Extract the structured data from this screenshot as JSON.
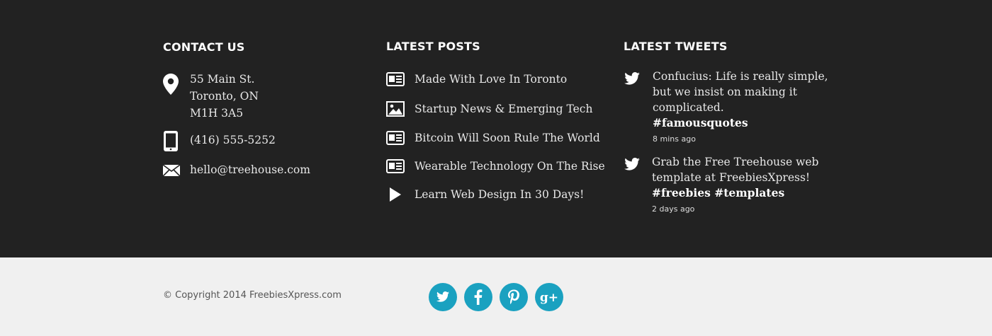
{
  "contact": {
    "title": "CONTACT US",
    "address": [
      "55 Main St.",
      "Toronto, ON",
      "M1H 3A5"
    ],
    "phone": "(416) 555-5252",
    "email": "hello@treehouse.com",
    "icons": [
      "map-pin-icon",
      "phone-icon",
      "envelope-icon"
    ]
  },
  "posts": {
    "title": "LATEST POSTS",
    "items": [
      {
        "label": "Made With Love In Toronto",
        "icon": "article-icon"
      },
      {
        "label": "Startup News & Emerging Tech",
        "icon": "image-icon"
      },
      {
        "label": "Bitcoin Will Soon Rule The World",
        "icon": "article-icon"
      },
      {
        "label": "Wearable Technology On The Rise",
        "icon": "article-icon"
      },
      {
        "label": "Learn Web Design In 30 Days!",
        "icon": "play-icon"
      }
    ]
  },
  "tweets": {
    "title": "LATEST TWEETS",
    "items": [
      {
        "text": "Confucius: Life is really simple, but we insist on making it complicated.",
        "tags": "#famousquotes",
        "time": "8 mins ago",
        "icon": "twitter-bird-icon"
      },
      {
        "text": "Grab the Free Treehouse web template at FreebiesXpress!",
        "tags": "#freebies #templates",
        "time": "2 days ago",
        "icon": "twitter-bird-icon"
      }
    ]
  },
  "footer": {
    "copyright": "© Copyright 2014 FreebiesXpress.com",
    "social": [
      {
        "name": "twitter",
        "icon": "twitter-icon"
      },
      {
        "name": "facebook",
        "icon": "facebook-icon"
      },
      {
        "name": "pinterest",
        "icon": "pinterest-icon"
      },
      {
        "name": "google-plus",
        "icon": "google-plus-icon"
      }
    ],
    "social_color": "#1aa1c0"
  },
  "colors": {
    "top_background": "#222222",
    "bottom_background": "#f0f0f0"
  }
}
